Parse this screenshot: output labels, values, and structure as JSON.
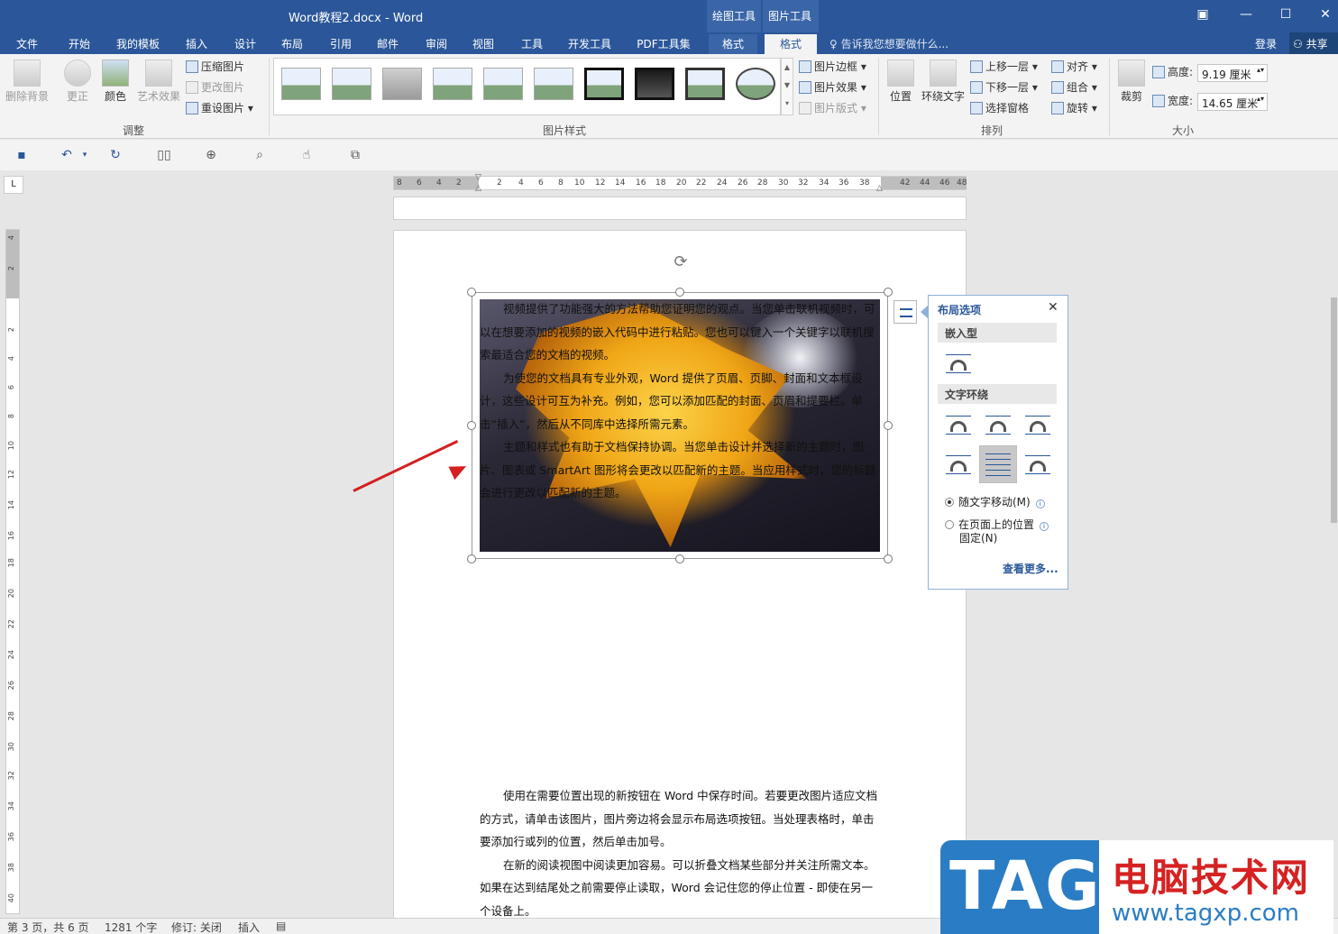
{
  "window": {
    "title": "Word教程2.docx - Word",
    "context_tabs": [
      "绘图工具",
      "图片工具"
    ]
  },
  "ribbon_tabs": [
    "文件",
    "开始",
    "我的模板",
    "插入",
    "设计",
    "布局",
    "引用",
    "邮件",
    "审阅",
    "视图",
    "工具",
    "开发工具",
    "PDF工具集",
    "格式",
    "格式"
  ],
  "tell_me": "告诉我您想要做什么...",
  "login": "登录",
  "share": "共享",
  "ribbon": {
    "adjust": {
      "remove_bg": "删除背景",
      "correct": "更正",
      "color": "颜色",
      "art_effect": "艺术效果",
      "compress": "压缩图片",
      "change_pic": "更改图片",
      "reset_pic": "重设图片",
      "label": "调整"
    },
    "styles": {
      "border": "图片边框",
      "effect": "图片效果",
      "layout": "图片版式",
      "label": "图片样式"
    },
    "arrange": {
      "position": "位置",
      "wrap_text": "环绕文字",
      "bring_forward": "上移一层",
      "send_backward": "下移一层",
      "selection_pane": "选择窗格",
      "align": "对齐",
      "group": "组合",
      "rotate": "旋转",
      "label": "排列"
    },
    "size": {
      "crop": "裁剪",
      "height_label": "高度:",
      "height_value": "9.19 厘米",
      "width_label": "宽度:",
      "width_value": "14.65 厘米",
      "label": "大小"
    }
  },
  "ruler_h_ticks": [
    "8",
    "6",
    "4",
    "2",
    "2",
    "4",
    "6",
    "8",
    "10",
    "12",
    "14",
    "16",
    "18",
    "20",
    "22",
    "24",
    "26",
    "28",
    "30",
    "32",
    "34",
    "36",
    "38",
    "42",
    "44",
    "46",
    "48"
  ],
  "ruler_v_ticks": [
    "4",
    "2",
    "2",
    "4",
    "6",
    "8",
    "10",
    "12",
    "14",
    "16",
    "18",
    "20",
    "22",
    "24",
    "26",
    "28",
    "30",
    "32",
    "34",
    "36",
    "38",
    "40"
  ],
  "ruler_corner": "L",
  "picture_text": [
    "视频提供了功能强大的方法帮助您证明您的观点。当您单击联机视频时，可以在想要添加的视频的嵌入代码中进行粘贴。您也可以键入一个关键字以联机搜索最适合您的文档的视频。",
    "为使您的文档具有专业外观，Word 提供了页眉、页脚、封面和文本框设计，这些设计可互为补充。例如，您可以添加匹配的封面、页眉和提要栏。单击“插入”，然后从不同库中选择所需元素。",
    "主题和样式也有助于文档保持协调。当您单击设计并选择新的主题时，图片、图表或 SmartArt 图形将会更改以匹配新的主题。当应用样式时，您的标题会进行更改以匹配新的主题。"
  ],
  "body_text": [
    "使用在需要位置出现的新按钮在 Word 中保存时间。若要更改图片适应文档的方式，请单击该图片，图片旁边将会显示布局选项按钮。当处理表格时，单击要添加行或列的位置，然后单击加号。",
    "在新的阅读视图中阅读更加容易。可以折叠文档某些部分并关注所需文本。如果在达到结尾处之前需要停止读取，Word 会记住您的停止位置 - 即使在另一个设备上。"
  ],
  "layout_panel": {
    "title": "布局选项",
    "inline_section": "嵌入型",
    "wrap_section": "文字环绕",
    "move_with_text": "随文字移动(M)",
    "fix_position_line1": "在页面上的位置",
    "fix_position_line2": "固定(N)",
    "see_more": "查看更多..."
  },
  "status": {
    "page": "第 3 页，共 6 页",
    "words": "1281 个字",
    "track": "修订: 关闭",
    "mode": "插入"
  },
  "watermark": {
    "tag": "TAG",
    "site_name": "电脑技术网",
    "url": "www.tagxp.com"
  },
  "colors": {
    "brand": "#2b579a",
    "arrow": "#d42020",
    "watermark_blue": "#2a7dc4",
    "watermark_red": "#d62222"
  }
}
